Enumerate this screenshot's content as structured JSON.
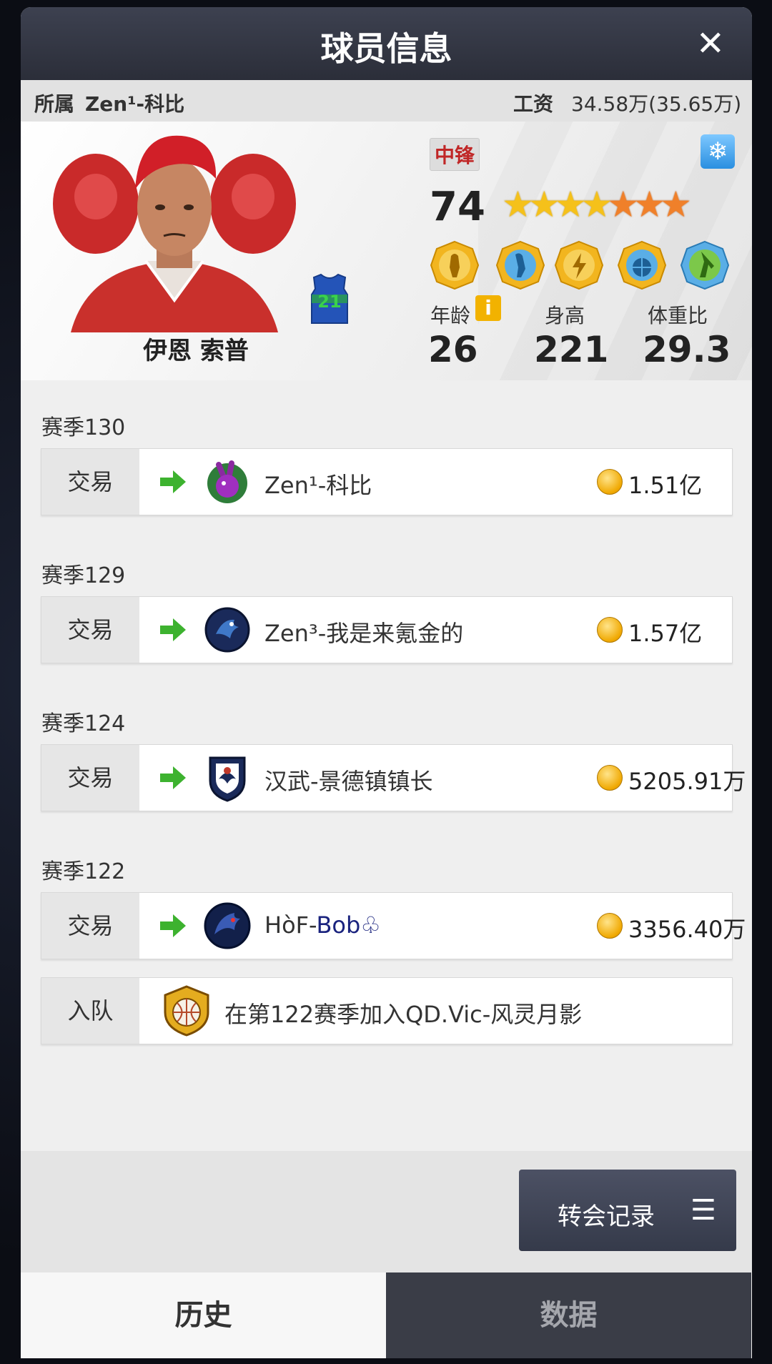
{
  "title": "球员信息",
  "close_icon": "close-icon",
  "info_bar": {
    "team_label": "所属",
    "team_value": "Zen¹-科比",
    "salary_label": "工资",
    "salary_value": "34.58万(35.65万)"
  },
  "player": {
    "name": "伊恩 索普",
    "jersey_number": "21",
    "position": "中锋",
    "overall": "74",
    "stars": {
      "gold": 4,
      "orange": 3,
      "total": 7
    },
    "stats": [
      {
        "label": "年龄",
        "value": "26"
      },
      {
        "label": "身高",
        "value": "221"
      },
      {
        "label": "体重比",
        "value": "29.3"
      }
    ],
    "badge_icons": [
      "post-badge-icon",
      "dunk-badge-icon",
      "speed-badge-icon",
      "ball-badge-icon",
      "block-badge-icon"
    ],
    "status_icon": "snowflake-icon",
    "info_icon": "info-icon"
  },
  "history": [
    {
      "season": "赛季130",
      "type": "交易",
      "team": "Zen¹-科比",
      "price": "1.51亿",
      "logo": "purple-rabbit-logo"
    },
    {
      "season": "赛季129",
      "type": "交易",
      "team": "Zen³-我是来氪金的",
      "price": "1.57亿",
      "logo": "blue-eagle-logo"
    },
    {
      "season": "赛季124",
      "type": "交易",
      "team": "汉武-景德镇镇长",
      "price": "5205.91万",
      "logo": "shield-eagle-logo"
    },
    {
      "season": "赛季122",
      "type": "交易",
      "team_prefix": "HòF-",
      "team_highlight": "Bob♧",
      "price": "3356.40万",
      "logo": "dark-griffin-logo"
    }
  ],
  "join": {
    "type": "入队",
    "text": "在第122赛季加入QD.Vic-风灵月影",
    "logo": "basketball-crest-logo"
  },
  "transfer_button": {
    "label": "转会记录",
    "icon": "menu-icon"
  },
  "tabs": [
    {
      "label": "历史",
      "active": true
    },
    {
      "label": "数据",
      "active": false
    }
  ],
  "colors": {
    "accent_red": "#c02727",
    "header_dark": "#2b2e39",
    "arrow_green": "#3db22f",
    "team_highlight": "#1a237e"
  }
}
